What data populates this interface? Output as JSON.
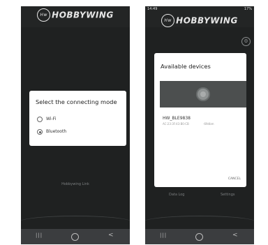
{
  "left_screen": {
    "logo_text": "HOBBYWING",
    "logo_mark": "Hw",
    "dialog": {
      "title": "Select the connecting mode",
      "options": [
        {
          "label": "Wi-Fi",
          "selected": false
        },
        {
          "label": "Bluetooth",
          "selected": true
        }
      ]
    },
    "footer_link": "Hobbywing Link",
    "navbar": {
      "back_icon": "|||",
      "home_icon": "circle-icon",
      "recent_icon": "<"
    }
  },
  "right_screen": {
    "status_time": "14:49",
    "status_right": "17%",
    "logo_text": "HOBBYWING",
    "logo_mark": "Hw",
    "dialog": {
      "title": "Available devices",
      "device_name": "HW_BLE9838",
      "device_address": "AC:23:3F:43:B0:CB",
      "device_rssi": "-69dbm",
      "cancel_label": "CANCEL"
    },
    "tabs": [
      "Data Log",
      "Settings"
    ],
    "navbar": {
      "back_icon": "|||",
      "home_icon": "circle-icon",
      "recent_icon": "<"
    }
  }
}
